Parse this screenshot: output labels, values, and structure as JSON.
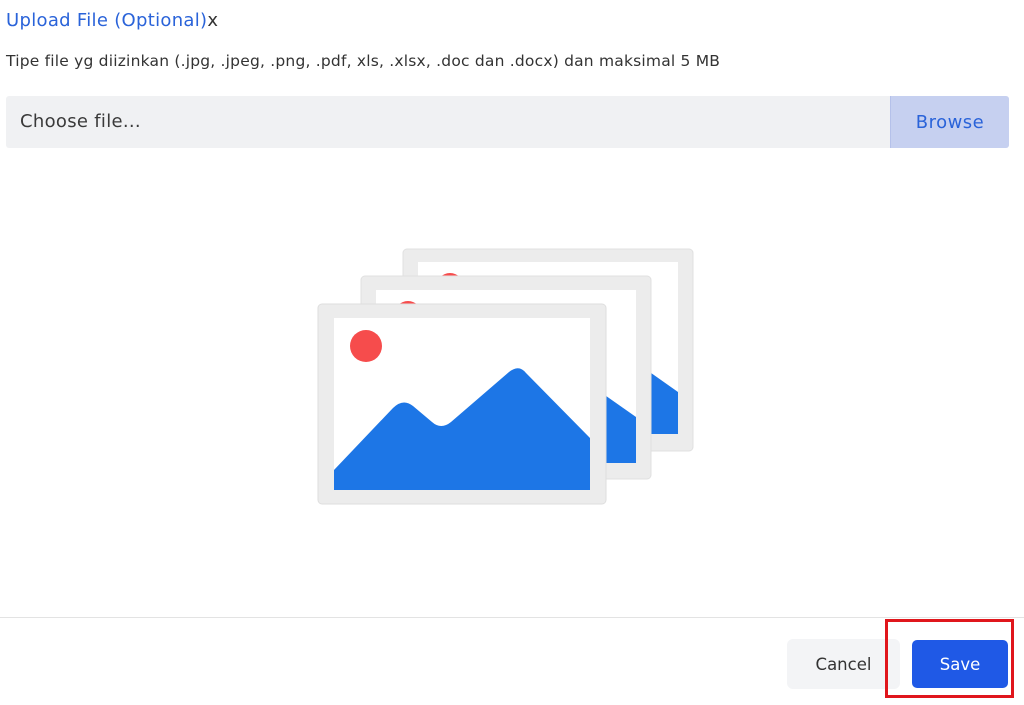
{
  "upload": {
    "title": "Upload File (Optional)",
    "close_mark": "x",
    "hint": "Tipe file yg diizinkan (.jpg, .jpeg, .png, .pdf, xls, .xlsx, .doc dan .docx) dan maksimal 5 MB",
    "placeholder": "Choose file...",
    "browse_label": "Browse"
  },
  "illustration": {
    "icon": "image-stack-icon",
    "sun_color": "#f64c4c",
    "mountain_color": "#1d76e6"
  },
  "footer": {
    "cancel_label": "Cancel",
    "save_label": "Save"
  },
  "colors": {
    "accent": "#2a63d9",
    "primary_button": "#1f59e6",
    "highlight": "#e0161c"
  }
}
